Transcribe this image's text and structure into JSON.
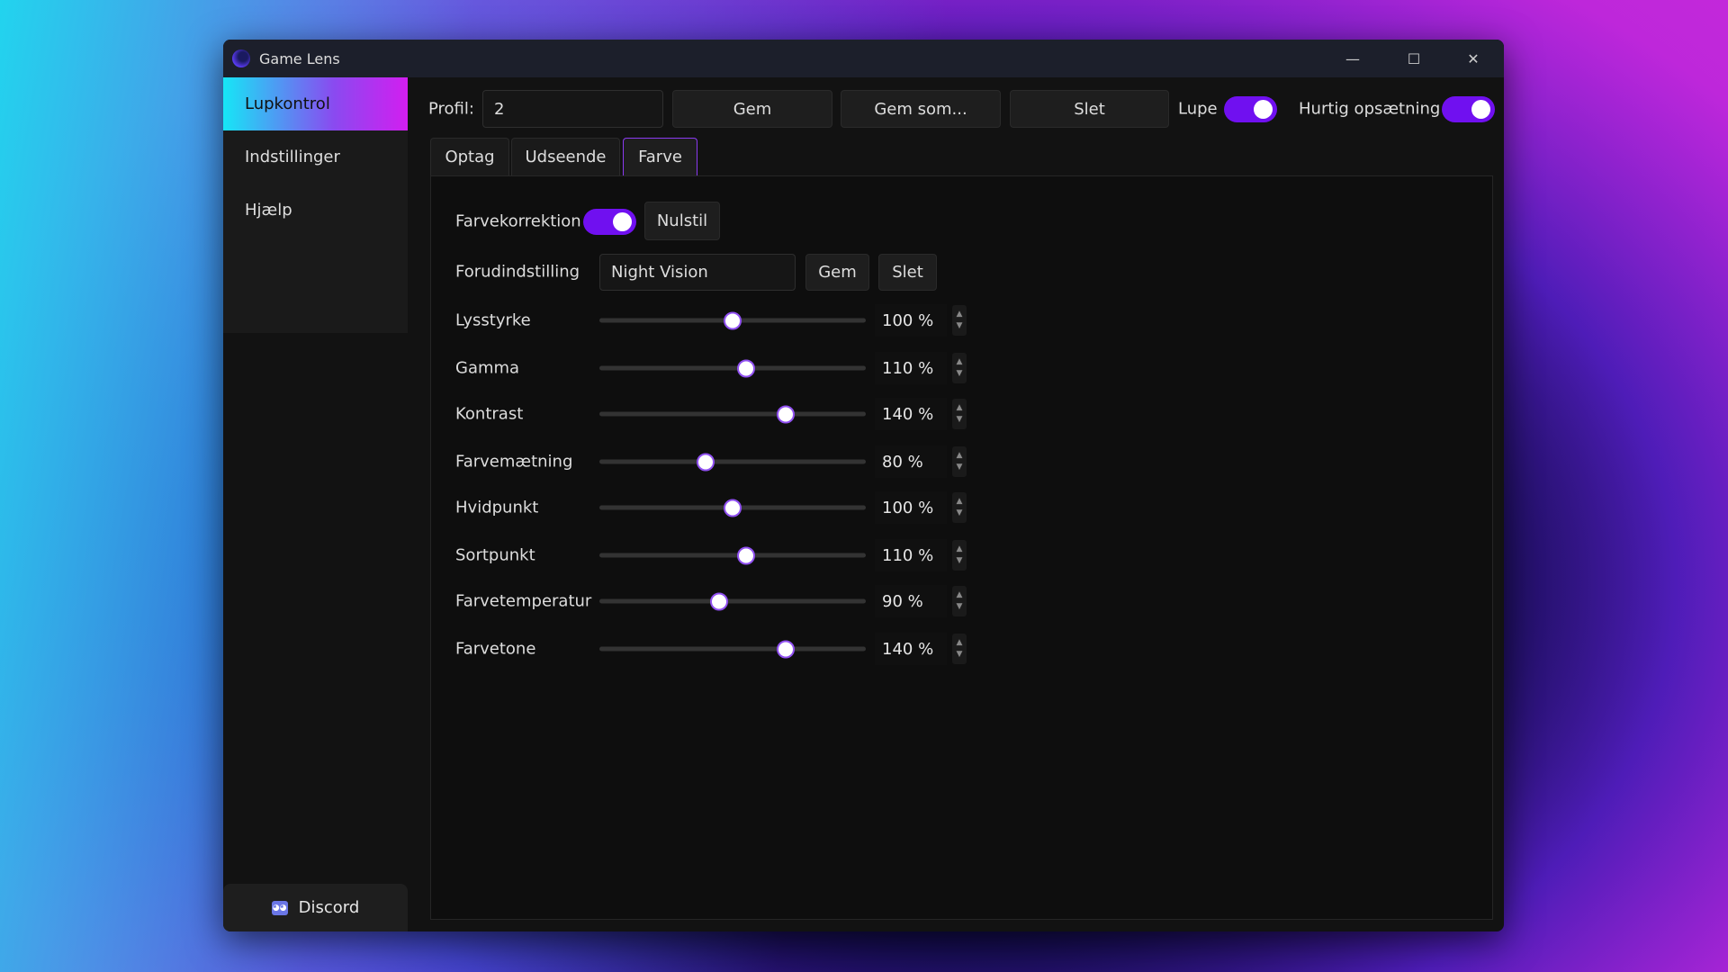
{
  "window": {
    "title": "Game Lens",
    "minimize": "—",
    "maximize": "☐",
    "close": "✕"
  },
  "sidebar": {
    "items": [
      {
        "label": "Lupkontrol",
        "active": true
      },
      {
        "label": "Indstillinger"
      },
      {
        "label": "Hjælp"
      }
    ],
    "discord": "Discord"
  },
  "toolbar": {
    "profile_label": "Profil:",
    "profile_value": "2",
    "save": "Gem",
    "save_as": "Gem som...",
    "delete": "Slet",
    "lupe_label": "Lupe",
    "lupe_on": true,
    "quick_label": "Hurtig opsætning",
    "quick_on": true
  },
  "tabs": [
    {
      "label": "Optag"
    },
    {
      "label": "Udseende"
    },
    {
      "label": "Farve",
      "active": true
    }
  ],
  "color": {
    "correction_label": "Farvekorrektion",
    "correction_on": true,
    "reset": "Nulstil",
    "preset_label": "Forudindstilling",
    "preset_value": "Night Vision",
    "preset_save": "Gem",
    "preset_delete": "Slet",
    "slider_range": [
      0,
      200
    ],
    "sliders": [
      {
        "label": "Lysstyrke",
        "value": 100,
        "display": "100 %"
      },
      {
        "label": "Gamma",
        "value": 110,
        "display": "110 %"
      },
      {
        "label": "Kontrast",
        "value": 140,
        "display": "140 %"
      },
      {
        "label": "Farvemætning",
        "value": 80,
        "display": "80 %"
      },
      {
        "label": "Hvidpunkt",
        "value": 100,
        "display": "100 %"
      },
      {
        "label": "Sortpunkt",
        "value": 110,
        "display": "110 %"
      },
      {
        "label": "Farvetemperatur",
        "value": 90,
        "display": "90 %"
      },
      {
        "label": "Farvetone",
        "value": 140,
        "display": "140 %"
      }
    ]
  },
  "colors": {
    "accent": "#7010f0"
  }
}
